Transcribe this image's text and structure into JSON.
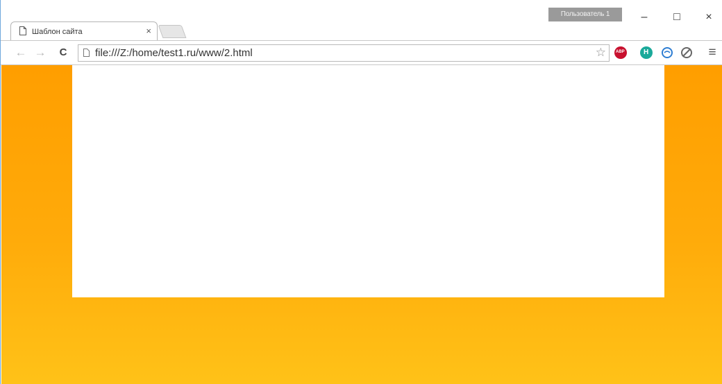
{
  "tab": {
    "title": "Шаблон сайта",
    "close_label": "×"
  },
  "profile": {
    "label": "Пользователь 1"
  },
  "window_controls": {
    "minimize": "–",
    "maximize": "□",
    "close": "×"
  },
  "toolbar": {
    "back": "←",
    "forward": "→",
    "reload": "C",
    "url": "file:///Z:/home/test1.ru/www/2.html",
    "bookmark": "☆",
    "menu": "≡"
  },
  "extensions": [
    {
      "name": "adblock-plus-icon",
      "label": "ABP",
      "color": "#c8102e"
    },
    {
      "name": "hola-icon",
      "label": "H",
      "color": "#1aa99a"
    },
    {
      "name": "sync-icon",
      "label": "",
      "color": "#2d7dd2"
    },
    {
      "name": "disable-icon",
      "label": "",
      "color": "#666666"
    }
  ],
  "page": {
    "background_top": "#ff9e00",
    "background_bottom": "#ffc218",
    "panel_color": "#ffffff"
  }
}
